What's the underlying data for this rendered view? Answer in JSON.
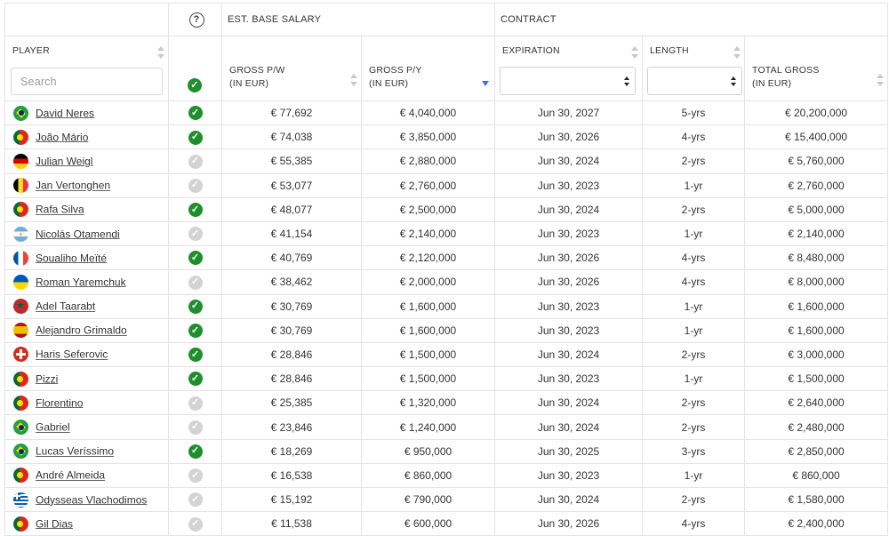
{
  "header": {
    "help_symbol": "?",
    "group_salary": "EST. BASE SALARY",
    "group_contract": "CONTRACT",
    "col_player": "PLAYER",
    "col_gross_pw_line1": "GROSS P/W",
    "col_gross_pw_line2": "(IN EUR)",
    "col_gross_py_line1": "GROSS P/Y",
    "col_gross_py_line2": "(IN EUR)",
    "col_expiration": "EXPIRATION",
    "col_length": "LENGTH",
    "col_total_line1": "TOTAL GROSS",
    "col_total_line2": "(IN EUR)"
  },
  "search": {
    "placeholder": "Search"
  },
  "colors": {
    "check_on": "#1f8f2e",
    "check_off": "#d3d3d3",
    "sort_active": "#4a6fd4"
  },
  "rows": [
    {
      "flag": "BR",
      "player": "David Neres",
      "check": true,
      "pw": "€ 77,692",
      "py": "€ 4,040,000",
      "expiration": "Jun 30, 2027",
      "length": "5-yrs",
      "total": "€ 20,200,000"
    },
    {
      "flag": "PT",
      "player": "João Mário",
      "check": true,
      "pw": "€ 74,038",
      "py": "€ 3,850,000",
      "expiration": "Jun 30, 2026",
      "length": "4-yrs",
      "total": "€ 15,400,000"
    },
    {
      "flag": "DE",
      "player": "Julian Weigl",
      "check": false,
      "pw": "€ 55,385",
      "py": "€ 2,880,000",
      "expiration": "Jun 30, 2024",
      "length": "2-yrs",
      "total": "€ 5,760,000"
    },
    {
      "flag": "BE",
      "player": "Jan Vertonghen",
      "check": false,
      "pw": "€ 53,077",
      "py": "€ 2,760,000",
      "expiration": "Jun 30, 2023",
      "length": "1-yr",
      "total": "€ 2,760,000"
    },
    {
      "flag": "PT",
      "player": "Rafa Silva",
      "check": true,
      "pw": "€ 48,077",
      "py": "€ 2,500,000",
      "expiration": "Jun 30, 2024",
      "length": "2-yrs",
      "total": "€ 5,000,000"
    },
    {
      "flag": "AR",
      "player": "Nicolás Otamendi",
      "check": false,
      "pw": "€ 41,154",
      "py": "€ 2,140,000",
      "expiration": "Jun 30, 2023",
      "length": "1-yr",
      "total": "€ 2,140,000"
    },
    {
      "flag": "FR",
      "player": "Soualiho Meïté",
      "check": true,
      "pw": "€ 40,769",
      "py": "€ 2,120,000",
      "expiration": "Jun 30, 2026",
      "length": "4-yrs",
      "total": "€ 8,480,000"
    },
    {
      "flag": "UA",
      "player": "Roman Yaremchuk",
      "check": false,
      "pw": "€ 38,462",
      "py": "€ 2,000,000",
      "expiration": "Jun 30, 2026",
      "length": "4-yrs",
      "total": "€ 8,000,000"
    },
    {
      "flag": "MA",
      "player": "Adel Taarabt",
      "check": true,
      "pw": "€ 30,769",
      "py": "€ 1,600,000",
      "expiration": "Jun 30, 2023",
      "length": "1-yr",
      "total": "€ 1,600,000"
    },
    {
      "flag": "ES",
      "player": "Alejandro Grimaldo",
      "check": true,
      "pw": "€ 30,769",
      "py": "€ 1,600,000",
      "expiration": "Jun 30, 2023",
      "length": "1-yr",
      "total": "€ 1,600,000"
    },
    {
      "flag": "CH",
      "player": "Haris Seferovic",
      "check": true,
      "pw": "€ 28,846",
      "py": "€ 1,500,000",
      "expiration": "Jun 30, 2024",
      "length": "2-yrs",
      "total": "€ 3,000,000"
    },
    {
      "flag": "PT",
      "player": "Pizzi",
      "check": true,
      "pw": "€ 28,846",
      "py": "€ 1,500,000",
      "expiration": "Jun 30, 2023",
      "length": "1-yr",
      "total": "€ 1,500,000"
    },
    {
      "flag": "PT",
      "player": "Florentino",
      "check": false,
      "pw": "€ 25,385",
      "py": "€ 1,320,000",
      "expiration": "Jun 30, 2024",
      "length": "2-yrs",
      "total": "€ 2,640,000"
    },
    {
      "flag": "BR",
      "player": "Gabriel",
      "check": false,
      "pw": "€ 23,846",
      "py": "€ 1,240,000",
      "expiration": "Jun 30, 2024",
      "length": "2-yrs",
      "total": "€ 2,480,000"
    },
    {
      "flag": "BR",
      "player": "Lucas Veríssimo",
      "check": true,
      "pw": "€ 18,269",
      "py": "€ 950,000",
      "expiration": "Jun 30, 2025",
      "length": "3-yrs",
      "total": "€ 2,850,000"
    },
    {
      "flag": "PT",
      "player": "André Almeida",
      "check": false,
      "pw": "€ 16,538",
      "py": "€ 860,000",
      "expiration": "Jun 30, 2023",
      "length": "1-yr",
      "total": "€ 860,000"
    },
    {
      "flag": "GR",
      "player": "Odysseas Vlachodimos",
      "check": false,
      "pw": "€ 15,192",
      "py": "€ 790,000",
      "expiration": "Jun 30, 2024",
      "length": "2-yrs",
      "total": "€ 1,580,000"
    },
    {
      "flag": "PT",
      "player": "Gil Dias",
      "check": false,
      "pw": "€ 11,538",
      "py": "€ 600,000",
      "expiration": "Jun 30, 2026",
      "length": "4-yrs",
      "total": "€ 2,400,000"
    }
  ]
}
